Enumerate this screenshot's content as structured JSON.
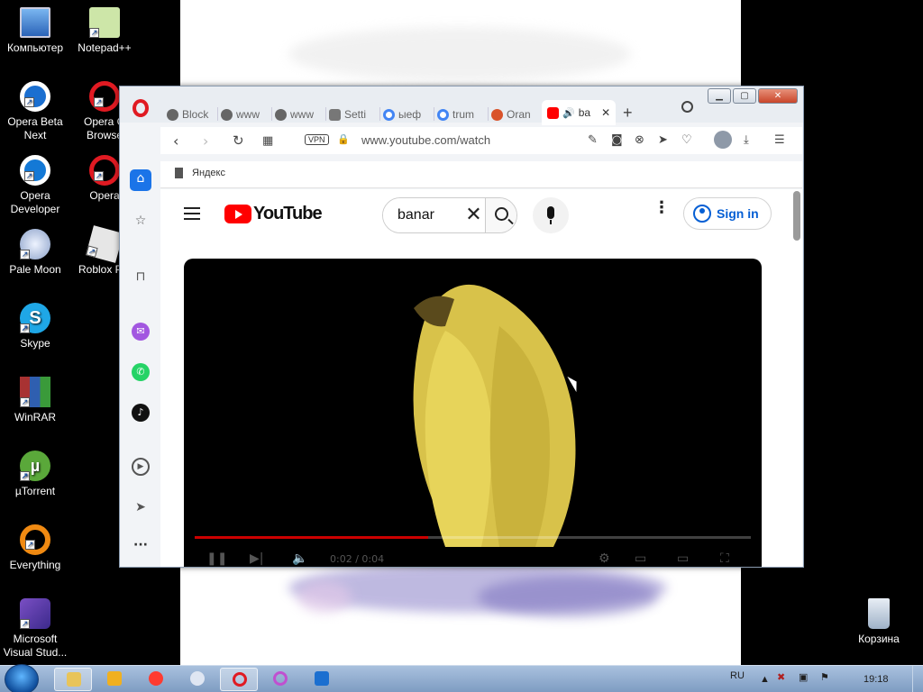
{
  "desktop": {
    "icons": [
      {
        "label": "Компьютер"
      },
      {
        "label": "Notepad++"
      },
      {
        "label": "Opera Beta Next"
      },
      {
        "label": "Opera G Browse"
      },
      {
        "label": "Opera Developer"
      },
      {
        "label": "Opera"
      },
      {
        "label": "Pale Moon"
      },
      {
        "label": "Roblox Pla"
      },
      {
        "label": "Skype"
      },
      {
        "label": "WinRAR"
      },
      {
        "label": "µTorrent"
      },
      {
        "label": "Everything"
      },
      {
        "label": "Microsoft Visual Stud..."
      },
      {
        "label": "Корзина"
      }
    ]
  },
  "browser": {
    "tabs": [
      {
        "label": "Block"
      },
      {
        "label": "www"
      },
      {
        "label": "www"
      },
      {
        "label": "Setti"
      },
      {
        "label": "ыеф"
      },
      {
        "label": "trum"
      },
      {
        "label": "Oran"
      },
      {
        "label": "ba",
        "active": true
      }
    ],
    "new_tab_label": "+",
    "address": {
      "vpn_label": "VPN",
      "url": "www.youtube.com/watch"
    },
    "bookmarks": [
      {
        "label": "Яндекс"
      }
    ],
    "window_buttons": {
      "minimize": "▁",
      "maximize": "▢",
      "close": "✕"
    }
  },
  "youtube": {
    "logo_text": "YouTube",
    "search_value": "banar",
    "search_clear": "✕",
    "more_glyph": "⋮",
    "signin_label": "Sign in",
    "player": {
      "progress_fraction": 0.42,
      "time_text": "0:02 / 0:04"
    }
  },
  "taskbar": {
    "language": "RU",
    "clock": "19:18"
  },
  "colors": {
    "youtube_red": "#ff0000",
    "opera_red": "#e01a22",
    "link_blue": "#065fd4"
  }
}
